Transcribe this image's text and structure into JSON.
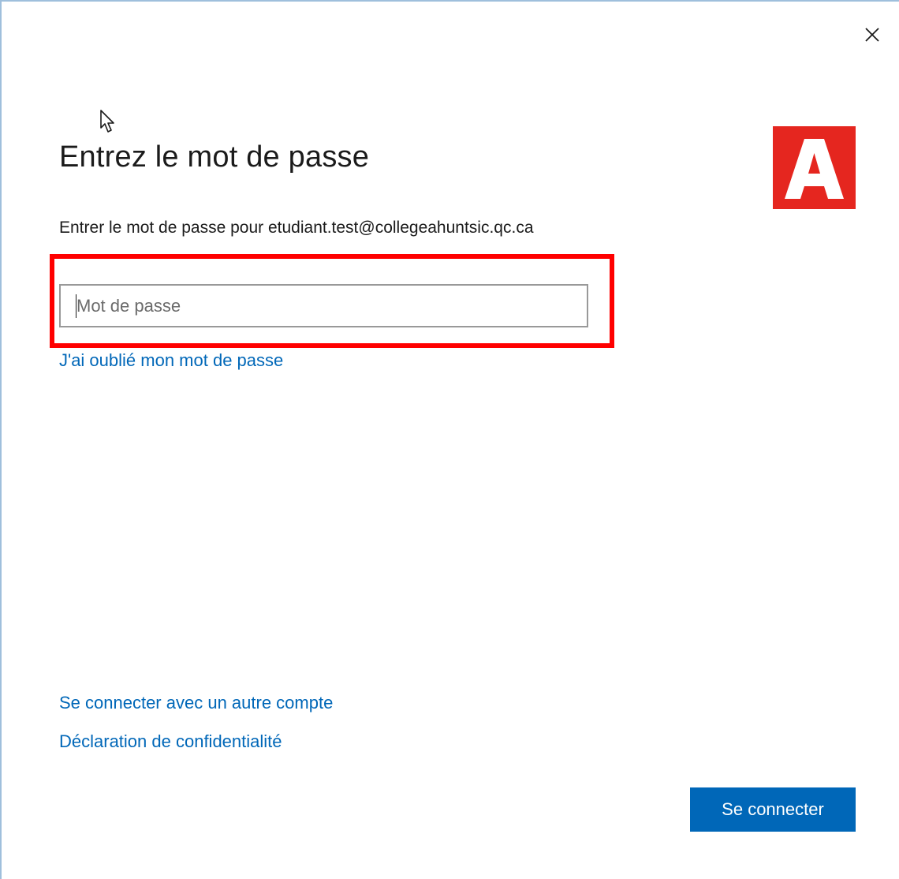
{
  "dialog": {
    "title": "Entrez le mot de passe",
    "subtitle": "Entrer le mot de passe pour etudiant.test@collegeahuntsic.qc.ca",
    "logo_letter": "A",
    "password_field": {
      "placeholder": "Mot de passe",
      "value": ""
    },
    "forgot_password_link": "J'ai oublié mon mot de passe",
    "other_account_link": "Se connecter avec un autre compte",
    "privacy_link": "Déclaration de confidentialité",
    "signin_button": "Se connecter"
  },
  "colors": {
    "accent": "#0067b8",
    "logo_red": "#e5261f",
    "highlight_red": "#ff0000"
  },
  "icons": {
    "close": "close-icon",
    "cursor": "mouse-pointer-icon"
  }
}
